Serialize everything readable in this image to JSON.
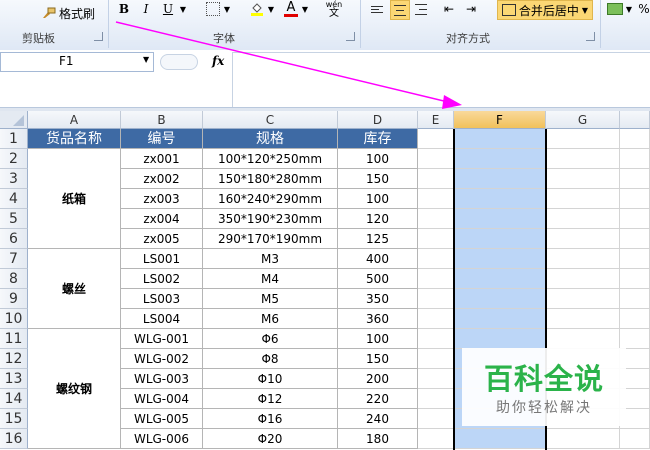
{
  "ribbon": {
    "format_painter_label": "格式刷",
    "clipboard_group": "剪贴板",
    "font_group": "字体",
    "align_group": "对齐方式",
    "bold": "B",
    "italic": "I",
    "underline": "U",
    "font_color_glyph": "A",
    "wen_glyph": "wén",
    "merge_center_label": "合并后居中",
    "percent": "%"
  },
  "formula_bar": {
    "name_box": "F1",
    "fx": "fx",
    "formula": ""
  },
  "columns": [
    "A",
    "B",
    "C",
    "D",
    "E",
    "F",
    "G"
  ],
  "selected_column": "F",
  "rows": [
    "1",
    "2",
    "3",
    "4",
    "5",
    "6",
    "7",
    "8",
    "9",
    "10",
    "11",
    "12",
    "13",
    "14",
    "15",
    "16"
  ],
  "table": {
    "headers": [
      "货品名称",
      "编号",
      "规格",
      "库存"
    ],
    "groups": [
      {
        "name": "纸箱",
        "rows": [
          [
            "zx001",
            "100*120*250mm",
            "100"
          ],
          [
            "zx002",
            "150*180*280mm",
            "150"
          ],
          [
            "zx003",
            "160*240*290mm",
            "100"
          ],
          [
            "zx004",
            "350*190*230mm",
            "120"
          ],
          [
            "zx005",
            "290*170*190mm",
            "125"
          ]
        ]
      },
      {
        "name": "螺丝",
        "rows": [
          [
            "LS001",
            "M3",
            "400"
          ],
          [
            "LS002",
            "M4",
            "500"
          ],
          [
            "LS003",
            "M5",
            "350"
          ],
          [
            "LS004",
            "M6",
            "360"
          ]
        ]
      },
      {
        "name": "螺纹钢",
        "rows": [
          [
            "WLG-001",
            "Φ6",
            "100"
          ],
          [
            "WLG-002",
            "Φ8",
            "150"
          ],
          [
            "WLG-003",
            "Φ10",
            "200"
          ],
          [
            "WLG-004",
            "Φ12",
            "220"
          ],
          [
            "WLG-005",
            "Φ16",
            "240"
          ],
          [
            "WLG-006",
            "Φ20",
            "180"
          ]
        ]
      }
    ]
  },
  "watermark": {
    "title": "百科全说",
    "subtitle": "助你轻松解决"
  },
  "colors": {
    "header_fill": "#3e6aa4",
    "selection_fill": "#bcd6f7",
    "arrow": "#ff00ff",
    "watermark_green": "#2bb34a"
  }
}
